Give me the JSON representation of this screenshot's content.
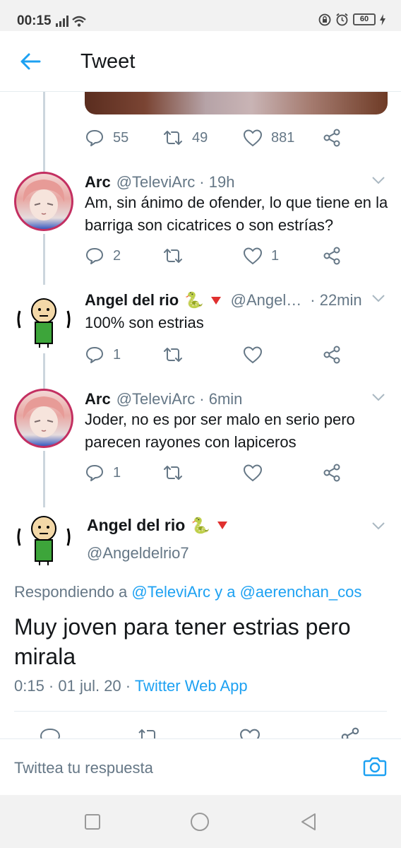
{
  "status_bar": {
    "time": "00:15",
    "battery": "60"
  },
  "header": {
    "title": "Tweet",
    "icons": {
      "back": "back-arrow-icon"
    }
  },
  "root_actions": {
    "replies": "55",
    "retweets": "49",
    "likes": "881"
  },
  "replies": [
    {
      "name": "Arc",
      "handle": "@TeleviArc",
      "time": "· 19h",
      "text": "Am, sin ánimo de ofender, lo que tiene en la barriga son cicatrices o son estrías?",
      "replies": "2",
      "retweets": "",
      "likes": "1"
    },
    {
      "name": "Angel del rio",
      "handle": "@Angel…",
      "time": "· 22min",
      "text": "100% son estrias",
      "replies": "1",
      "retweets": "",
      "likes": ""
    },
    {
      "name": "Arc",
      "handle": "@TeleviArc",
      "time": "· 6min",
      "text": "Joder, no es por ser malo en serio pero parecen rayones con lapiceros",
      "replies": "1",
      "retweets": "",
      "likes": ""
    }
  ],
  "main_tweet": {
    "name": "Angel del rio",
    "handle": "@Angeldelrio7",
    "replying_prefix": "Respondiendo a",
    "replying_to_1": "@TeleviArc",
    "replying_joiner": "y a",
    "replying_to_2": "@aerenchan_cos",
    "text": "Muy joven para tener estrias pero mirala",
    "timestamp": "0:15 · 01 jul. 20 ·",
    "source": "Twitter Web App"
  },
  "compose": {
    "placeholder": "Twittea tu respuesta"
  },
  "colors": {
    "accent": "#1da1f2",
    "muted": "#657786",
    "thread": "#ccd6dd"
  }
}
